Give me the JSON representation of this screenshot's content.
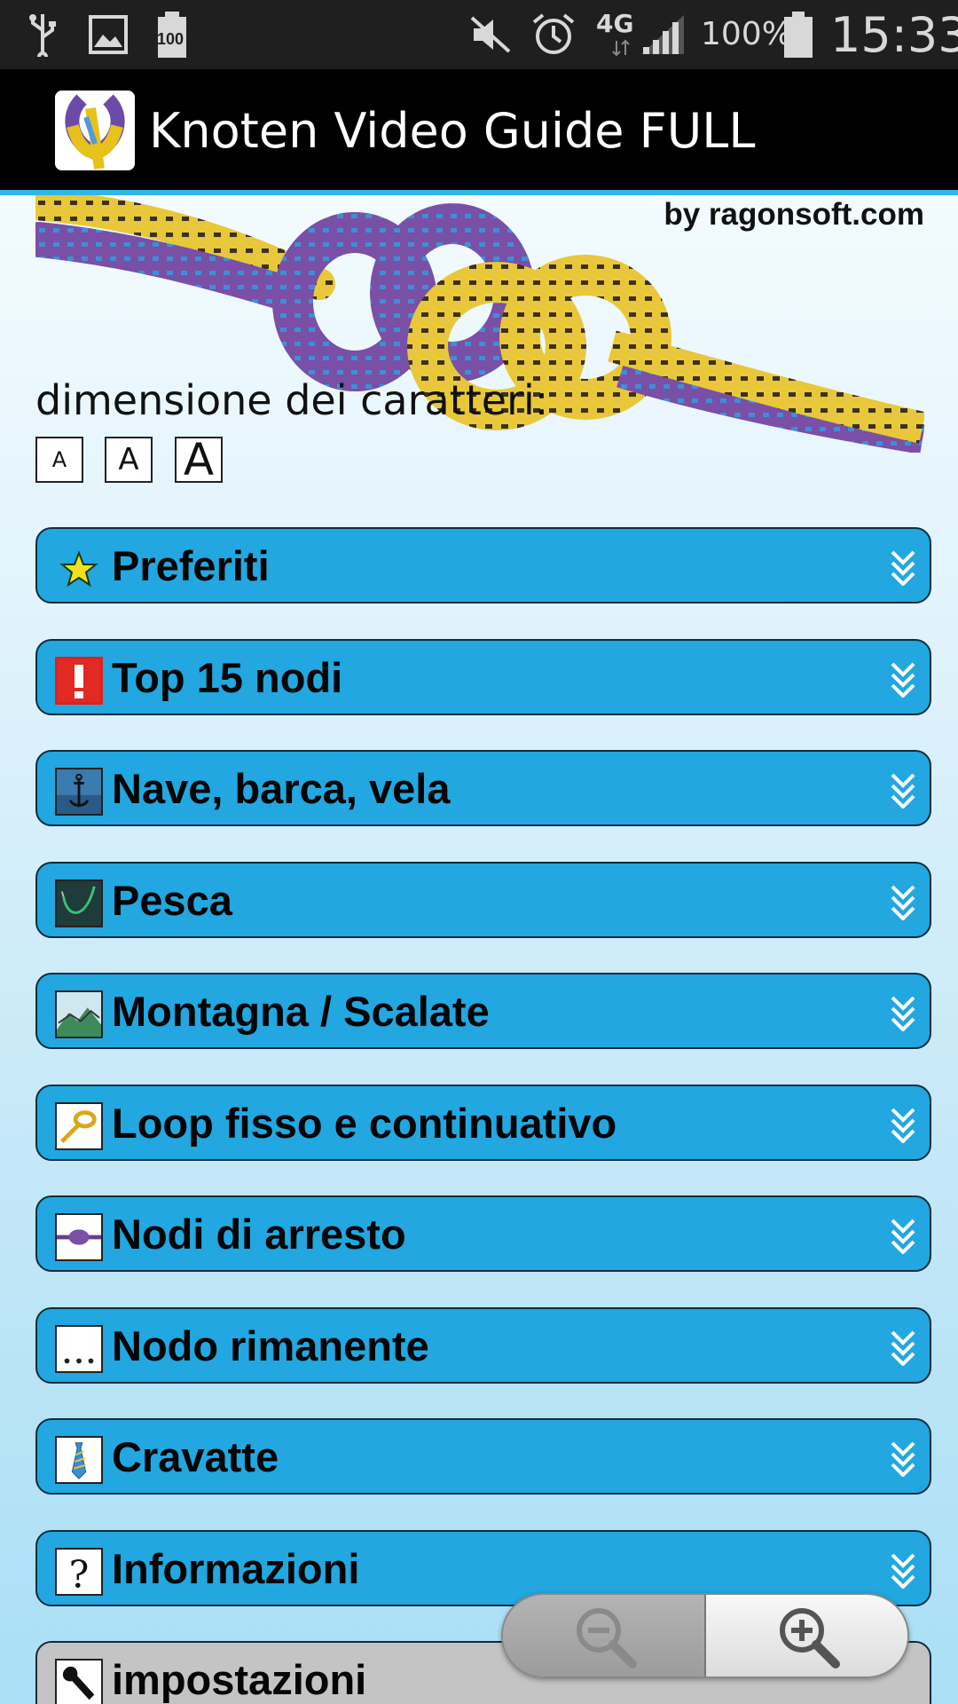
{
  "status_bar": {
    "icons": [
      "usb-icon",
      "image-notification-icon",
      "battery-100-notification-icon",
      "mute-icon",
      "alarm-icon",
      "4g-icon",
      "signal-icon",
      "battery-icon"
    ],
    "network": "4G",
    "battery_small_label": "100",
    "battery_percent": "100%",
    "time": "15:33"
  },
  "action_bar": {
    "title": "Knoten Video Guide FULL",
    "icon": "knot-app-icon"
  },
  "header": {
    "byline": "by ragonsoft.com",
    "font_size_label": "dimensione dei caratteri:",
    "font_buttons": [
      "A",
      "A",
      "A"
    ]
  },
  "categories": [
    {
      "label": "Preferiti",
      "icon": "star-icon"
    },
    {
      "label": "Top 15 nodi",
      "icon": "exclamation-icon"
    },
    {
      "label": "Nave, barca, vela",
      "icon": "anchor-icon"
    },
    {
      "label": "Pesca",
      "icon": "fishing-hook-icon"
    },
    {
      "label": "Montagna / Scalate",
      "icon": "mountain-icon"
    },
    {
      "label": "Loop fisso e continuativo",
      "icon": "loop-icon"
    },
    {
      "label": "Nodi di arresto",
      "icon": "stopper-knot-icon"
    },
    {
      "label": "Nodo rimanente",
      "icon": "ellipsis-icon"
    },
    {
      "label": "Cravatte",
      "icon": "tie-icon"
    },
    {
      "label": "Informazioni",
      "icon": "question-icon"
    },
    {
      "label": "impostazioni",
      "icon": "wrench-icon"
    }
  ],
  "zoom": {
    "out_icon": "zoom-out-icon",
    "in_icon": "zoom-in-icon"
  },
  "colors": {
    "category_bg": "#22a7e0",
    "settings_bg": "#c4c4c4",
    "accent_line": "#33b5e5"
  }
}
